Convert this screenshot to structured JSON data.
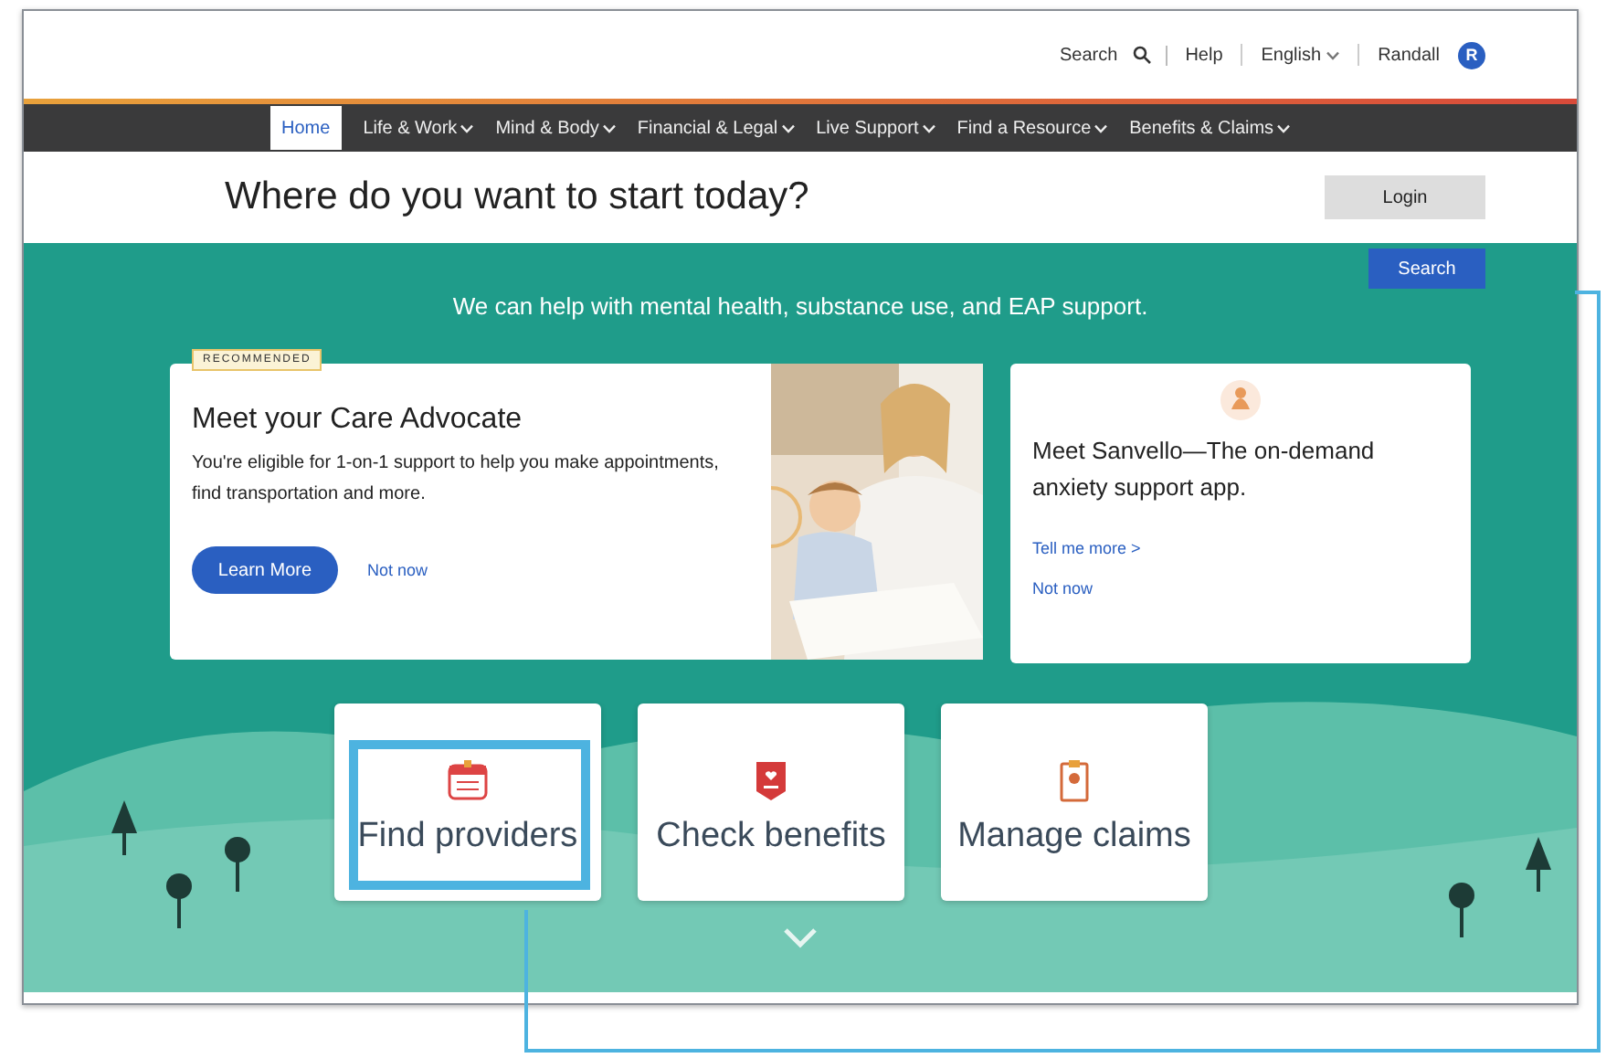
{
  "header": {
    "search": "Search",
    "links": [
      "Help",
      "English",
      "Randall"
    ],
    "avatar": "R"
  },
  "nav": [
    {
      "label": "Home",
      "selected": true,
      "dropdown": false
    },
    {
      "label": "Life & Work",
      "selected": false,
      "dropdown": true
    },
    {
      "label": "Mind & Body",
      "selected": false,
      "dropdown": true
    },
    {
      "label": "Financial & Legal",
      "selected": false,
      "dropdown": true
    },
    {
      "label": "Live Support",
      "selected": false,
      "dropdown": true
    },
    {
      "label": "Find a Resource",
      "selected": false,
      "dropdown": true
    },
    {
      "label": "Benefits & Claims",
      "selected": false,
      "dropdown": true
    }
  ],
  "page_title": "Where do you want to start today?",
  "login": "Login",
  "hero": {
    "search": "Search",
    "headline": "We can help with mental health, substance use, and EAP support.",
    "advocate_card": {
      "badge": "RECOMMENDED",
      "title": "Meet your Care Advocate",
      "text": "You're eligible for 1-on-1 support to help you make appointments, find transportation and more.",
      "primary": "Learn More",
      "secondary": "Not now"
    },
    "app_card": {
      "title": "Meet Sanvello—The on-demand anxiety support app.",
      "links": [
        "Tell me more >",
        "Not now"
      ]
    },
    "tiles": [
      {
        "label": "Find providers",
        "kind": "calendar",
        "highlighted": true
      },
      {
        "label": "Check benefits",
        "kind": "badge",
        "highlighted": false
      },
      {
        "label": "Manage claims",
        "kind": "clipboard",
        "highlighted": false
      }
    ]
  }
}
